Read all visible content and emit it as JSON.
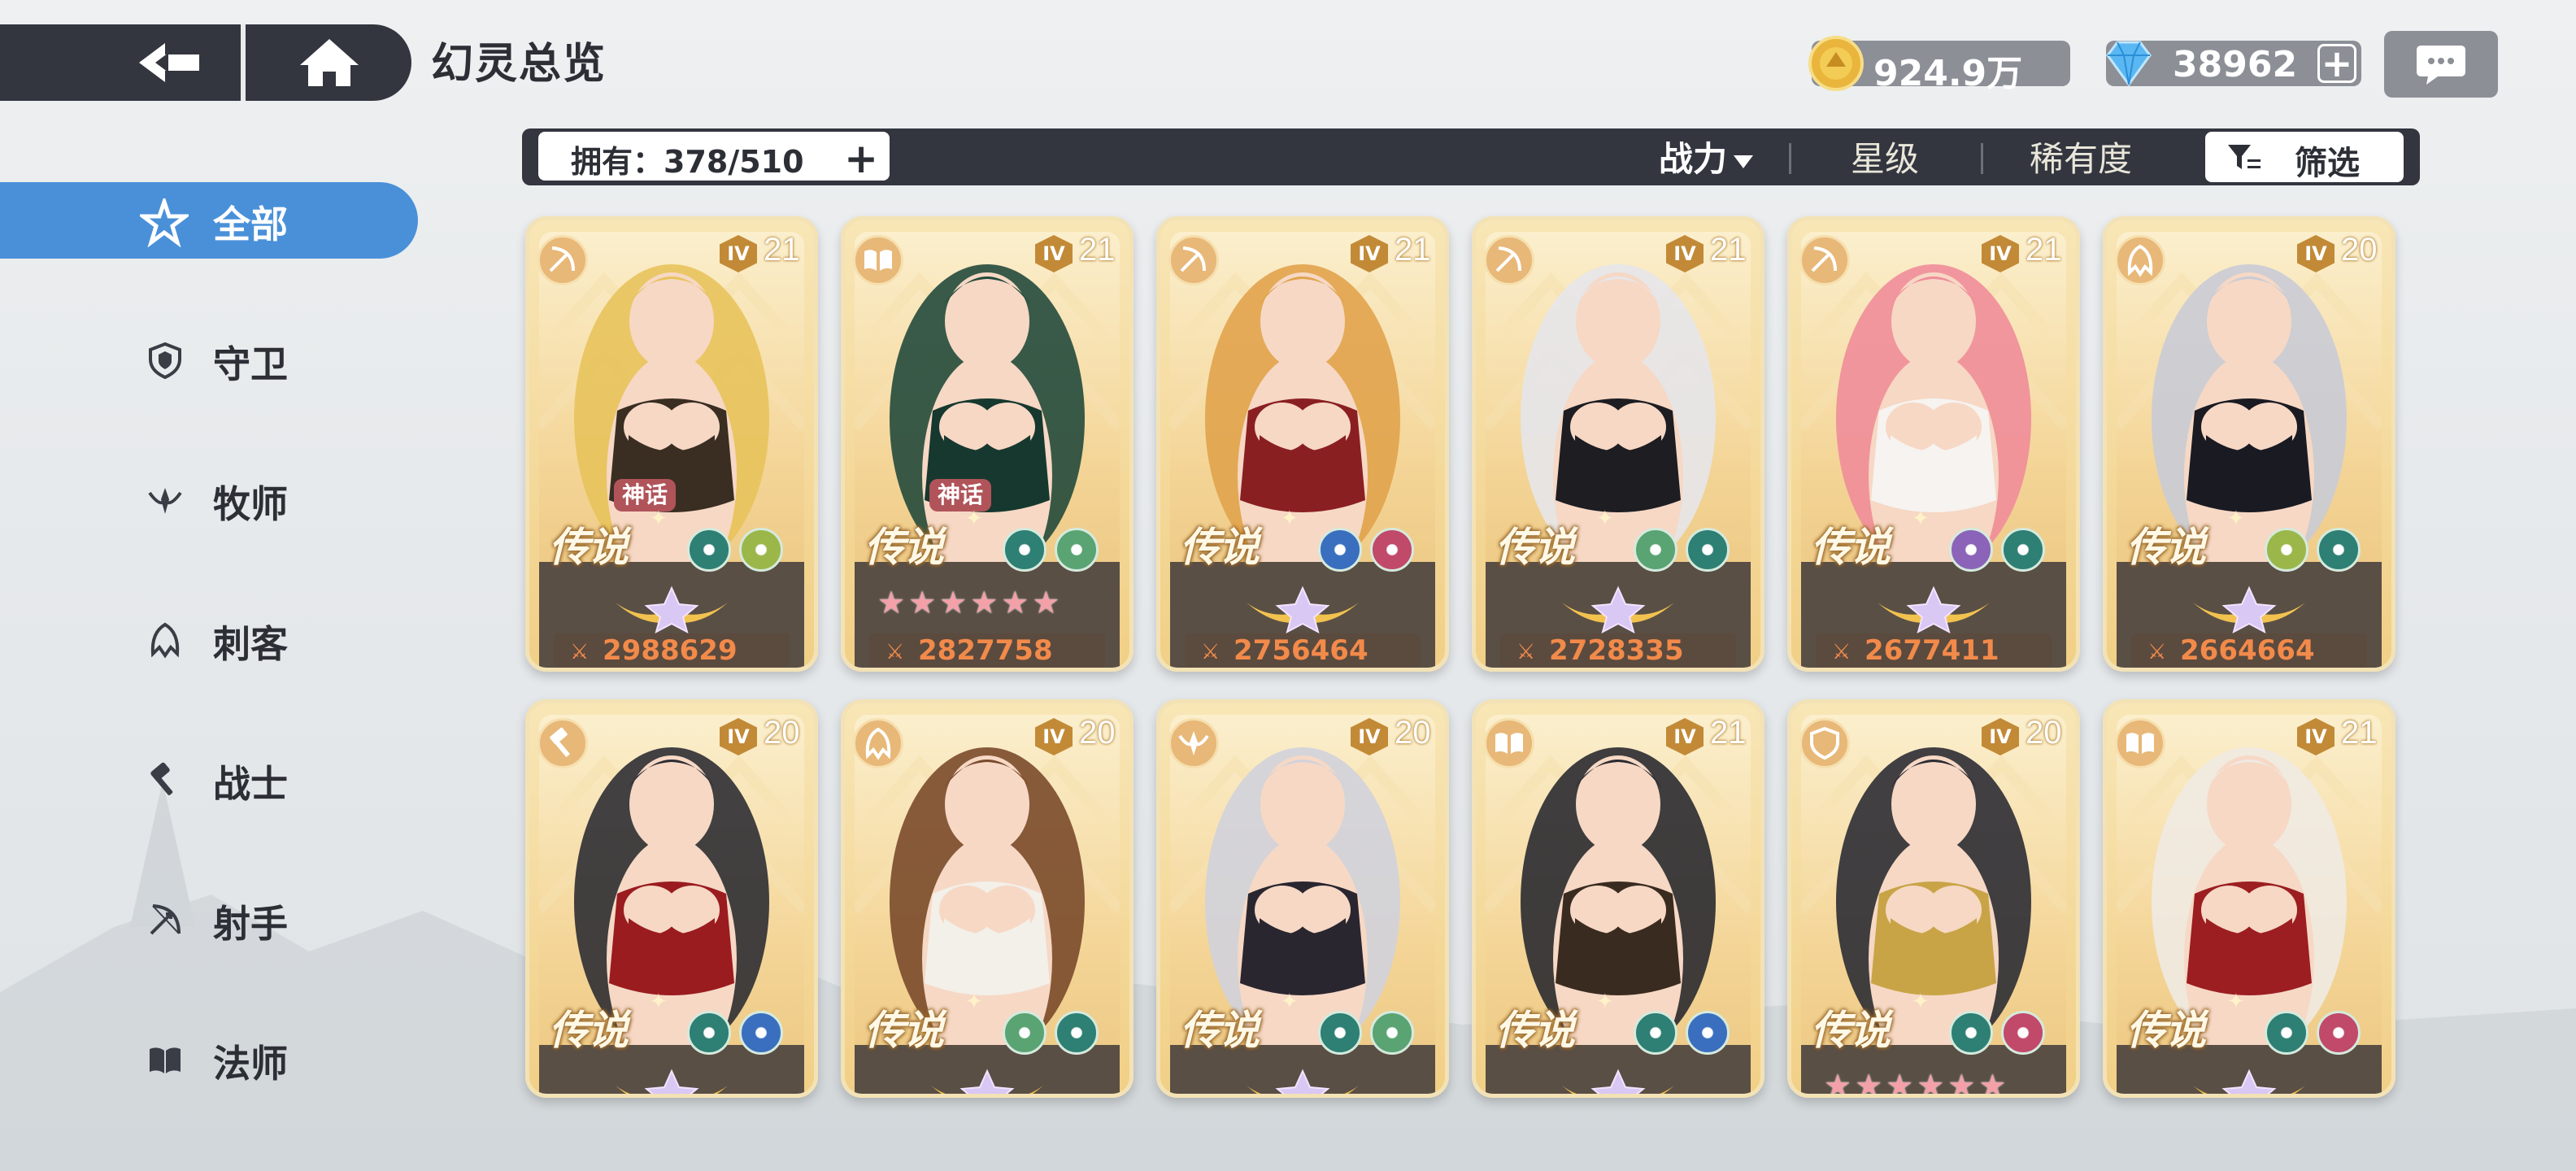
{
  "header": {
    "title": "幻灵总览",
    "gold": "924.9万",
    "gems": "38962"
  },
  "filter": {
    "owned": "拥有：378/510",
    "sort_power": "战力",
    "sort_star": "星级",
    "sort_rarity": "稀有度",
    "filter_label": "筛选"
  },
  "sidebar": {
    "items": [
      {
        "label": "全部",
        "icon": "all-classes-icon"
      },
      {
        "label": "守卫",
        "icon": "guard-shield-icon"
      },
      {
        "label": "牧师",
        "icon": "priest-icon"
      },
      {
        "label": "刺客",
        "icon": "assassin-icon"
      },
      {
        "label": "战士",
        "icon": "warrior-hammer-icon"
      },
      {
        "label": "射手",
        "icon": "archer-bow-icon"
      },
      {
        "label": "法师",
        "icon": "mage-book-icon"
      }
    ]
  },
  "cards": [
    {
      "level": "21",
      "rarity": "传说",
      "tag": "神话",
      "power": "2988629",
      "class": "archer",
      "stars": "wing"
    },
    {
      "level": "21",
      "rarity": "传说",
      "tag": "神话",
      "power": "2827758",
      "class": "mage",
      "stars": "pink"
    },
    {
      "level": "21",
      "rarity": "传说",
      "tag": "",
      "power": "2756464",
      "class": "archer",
      "stars": "wing"
    },
    {
      "level": "21",
      "rarity": "传说",
      "tag": "",
      "power": "2728335",
      "class": "archer",
      "stars": "wing"
    },
    {
      "level": "21",
      "rarity": "传说",
      "tag": "",
      "power": "2677411",
      "class": "archer",
      "stars": "wing"
    },
    {
      "level": "20",
      "rarity": "传说",
      "tag": "",
      "power": "2664664",
      "class": "assassin",
      "stars": "wing"
    },
    {
      "level": "20",
      "rarity": "传说",
      "tag": "",
      "power": "",
      "class": "warrior",
      "stars": "wing"
    },
    {
      "level": "20",
      "rarity": "传说",
      "tag": "",
      "power": "",
      "class": "assassin",
      "stars": "wing"
    },
    {
      "level": "20",
      "rarity": "传说",
      "tag": "",
      "power": "",
      "class": "priest",
      "stars": "wing"
    },
    {
      "level": "21",
      "rarity": "传说",
      "tag": "",
      "power": "",
      "class": "mage",
      "stars": "wing"
    },
    {
      "level": "20",
      "rarity": "传说",
      "tag": "",
      "power": "",
      "class": "guard",
      "stars": "pink"
    },
    {
      "level": "21",
      "rarity": "传说",
      "tag": "",
      "power": "",
      "class": "mage",
      "stars": "wing"
    }
  ],
  "colors": {
    "accent": "#4a90d9",
    "bar": "#33363f",
    "power": "#f28a4a"
  }
}
